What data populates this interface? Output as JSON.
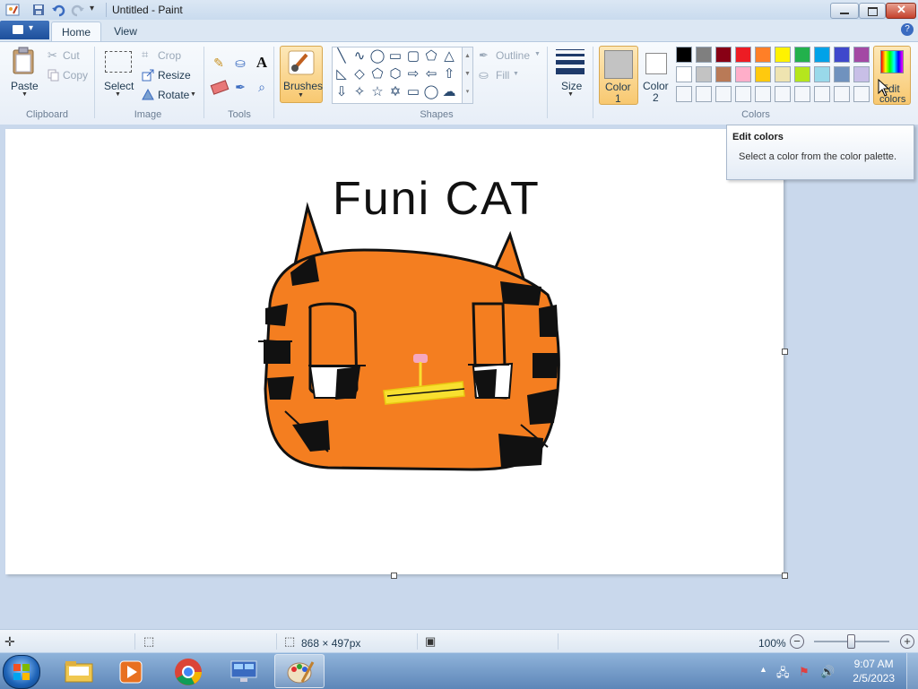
{
  "window": {
    "title": "Untitled - Paint"
  },
  "tabs": [
    {
      "label": "Home"
    },
    {
      "label": "View"
    }
  ],
  "clipboard": {
    "paste": "Paste",
    "cut": "Cut",
    "copy": "Copy",
    "group": "Clipboard"
  },
  "image": {
    "select": "Select",
    "crop": "Crop",
    "resize": "Resize",
    "rotate": "Rotate",
    "group": "Image"
  },
  "tools": {
    "group": "Tools"
  },
  "brushes": {
    "label": "Brushes"
  },
  "shapes": {
    "outline": "Outline",
    "fill": "Fill",
    "group": "Shapes"
  },
  "size": {
    "label": "Size"
  },
  "colors": {
    "color1": "Color",
    "color1_num": "1",
    "color2": "Color",
    "color2_num": "2",
    "edit_line1": "Edit",
    "edit_line2": "colors",
    "group": "Colors",
    "color1_value": "#c3c3c3",
    "color2_value": "#ffffff",
    "palette_row1": [
      "#000000",
      "#7f7f7f",
      "#880015",
      "#ed1c24",
      "#ff7f27",
      "#fff200",
      "#22b14c",
      "#00a2e8",
      "#3f48cc",
      "#a349a4"
    ],
    "palette_row2": [
      "#ffffff",
      "#c3c3c3",
      "#b97a57",
      "#ffaec9",
      "#ffc90e",
      "#efe4b0",
      "#b5e61d",
      "#99d9ea",
      "#7092be",
      "#c8bfe7"
    ]
  },
  "tooltip": {
    "title": "Edit colors",
    "body": "Select a color from the color palette."
  },
  "status": {
    "dimensions": "868 × 497px",
    "zoom": "100%"
  },
  "drawing": {
    "text": "Funi CAT"
  },
  "taskbar": {
    "time": "9:07 AM",
    "date": "2/5/2023"
  }
}
